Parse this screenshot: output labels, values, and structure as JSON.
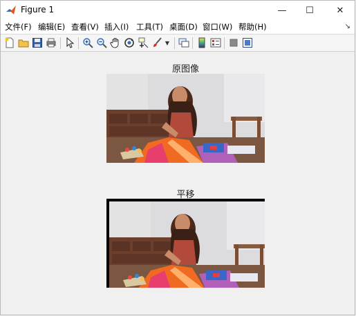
{
  "window": {
    "title": "Figure 1",
    "minimize_glyph": "—",
    "maximize_glyph": "☐",
    "close_glyph": "✕"
  },
  "menu": {
    "items": [
      "文件(F)",
      "编辑(E)",
      "查看(V)",
      "插入(I)",
      "工具(T)",
      "桌面(D)",
      "窗口(W)",
      "帮助(H)"
    ],
    "dock_glyph": "↘"
  },
  "toolbar": {
    "buttons": [
      "new-figure",
      "open-file",
      "save",
      "print",
      "select-pointer",
      "zoom-in",
      "zoom-out",
      "pan-hand",
      "rotate-3d",
      "data-cursor",
      "brush",
      "link-plot",
      "colorbar",
      "legend",
      "hide-plot-tools",
      "show-plot-tools"
    ]
  },
  "figure": {
    "axes": [
      {
        "title": "原图像"
      },
      {
        "title": "平移"
      }
    ]
  },
  "colors": {
    "window_bg": "#f0f0f0",
    "titlebar_bg": "#ffffff",
    "wall": "#dcdcde",
    "table": "#6b4a34",
    "fabric_orange": "#f06a22"
  }
}
